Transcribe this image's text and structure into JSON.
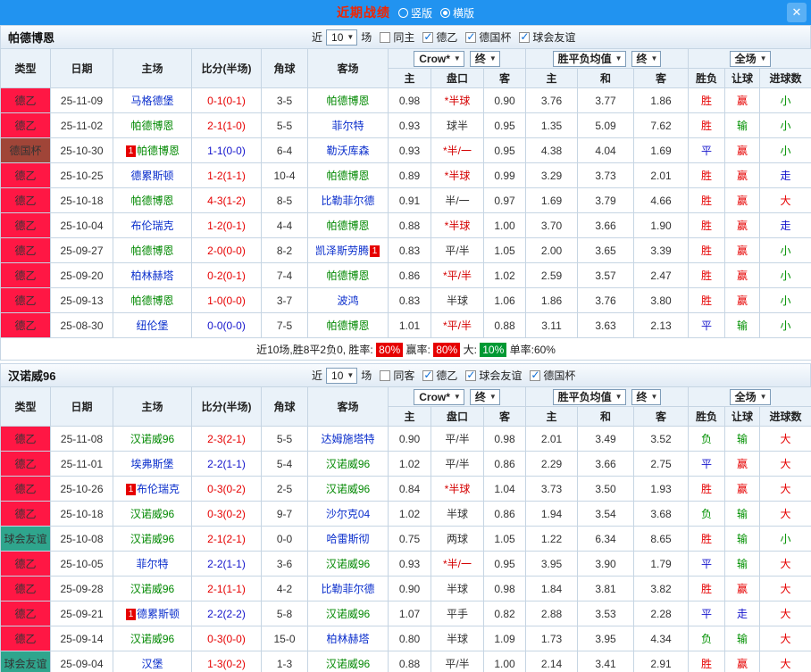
{
  "colors": {
    "topbar_bg": "#2193f0",
    "title": "#f22500",
    "win": "#e60000",
    "draw": "#1414cc",
    "lose": "#009000",
    "self_team": "#008800",
    "opp_team": "#0a2ecc",
    "odds": "#294f8a",
    "handicap_star": "#d40000",
    "type": {
      "德乙": "#ff1744",
      "德国杯": "#a04538",
      "球会友谊": "#2fa58d"
    }
  },
  "badge_text": "1",
  "topbar": {
    "title": "近期战绩",
    "vertical_label": "竖版",
    "horizontal_label": "横版",
    "selected": "横版",
    "close_glyph": "✕"
  },
  "table_header": {
    "type": "类型",
    "date": "日期",
    "home": "主场",
    "score": "比分(半场)",
    "corner": "角球",
    "away": "客场",
    "bookmaker": "Crow*",
    "final": "终",
    "europe": "胜平负均值",
    "scope": "全场",
    "sub": [
      "主",
      "盘口",
      "客",
      "主",
      "和",
      "客",
      "胜负",
      "让球",
      "进球数"
    ]
  },
  "sections": [
    {
      "team": "帕德博恩",
      "filter": {
        "near_label": "近",
        "count": "10",
        "games_label": "场",
        "same_label": "同主",
        "same_checked": false,
        "leagues": [
          {
            "label": "德乙",
            "checked": true
          },
          {
            "label": "德国杯",
            "checked": true
          },
          {
            "label": "球会友谊",
            "checked": true
          }
        ]
      },
      "rows": [
        {
          "lg": "德乙",
          "d": "25-11-09",
          "h": "马格德堡",
          "hc": "b",
          "s": "0-1(0-1)",
          "sc": "r",
          "cn": "3-5",
          "a": "帕德博恩",
          "ac": "g",
          "o": [
            "0.98",
            "*半球",
            "0.90",
            "3.76",
            "3.77",
            "1.86"
          ],
          "r": [
            "胜",
            "赢",
            "小"
          ]
        },
        {
          "lg": "德乙",
          "d": "25-11-02",
          "h": "帕德博恩",
          "hc": "g",
          "s": "2-1(1-0)",
          "sc": "r",
          "cn": "5-5",
          "a": "菲尔特",
          "ac": "b",
          "o": [
            "0.93",
            "球半",
            "0.95",
            "1.35",
            "5.09",
            "7.62"
          ],
          "r": [
            "胜",
            "输",
            "小"
          ]
        },
        {
          "lg": "德国杯",
          "d": "25-10-30",
          "h": "帕德博恩",
          "hc": "g",
          "hb": "pre",
          "s": "1-1(0-0)",
          "sc": "d",
          "cn": "6-4",
          "a": "勒沃库森",
          "ac": "b",
          "o": [
            "0.93",
            "*半/一",
            "0.95",
            "4.38",
            "4.04",
            "1.69"
          ],
          "r": [
            "平",
            "赢",
            "小"
          ]
        },
        {
          "lg": "德乙",
          "d": "25-10-25",
          "h": "德累斯顿",
          "hc": "b",
          "s": "1-2(1-1)",
          "sc": "r",
          "cn": "10-4",
          "a": "帕德博恩",
          "ac": "g",
          "o": [
            "0.89",
            "*半球",
            "0.99",
            "3.29",
            "3.73",
            "2.01"
          ],
          "r": [
            "胜",
            "赢",
            "走"
          ]
        },
        {
          "lg": "德乙",
          "d": "25-10-18",
          "h": "帕德博恩",
          "hc": "g",
          "s": "4-3(1-2)",
          "sc": "r",
          "cn": "8-5",
          "a": "比勒菲尔德",
          "ac": "b",
          "o": [
            "0.91",
            "半/一",
            "0.97",
            "1.69",
            "3.79",
            "4.66"
          ],
          "r": [
            "胜",
            "赢",
            "大"
          ]
        },
        {
          "lg": "德乙",
          "d": "25-10-04",
          "h": "布伦瑞克",
          "hc": "b",
          "s": "1-2(0-1)",
          "sc": "r",
          "cn": "4-4",
          "a": "帕德博恩",
          "ac": "g",
          "o": [
            "0.88",
            "*半球",
            "1.00",
            "3.70",
            "3.66",
            "1.90"
          ],
          "r": [
            "胜",
            "赢",
            "走"
          ]
        },
        {
          "lg": "德乙",
          "d": "25-09-27",
          "h": "帕德博恩",
          "hc": "g",
          "s": "2-0(0-0)",
          "sc": "r",
          "cn": "8-2",
          "a": "凯泽斯劳腾",
          "ac": "b",
          "ab": "post",
          "o": [
            "0.83",
            "平/半",
            "1.05",
            "2.00",
            "3.65",
            "3.39"
          ],
          "r": [
            "胜",
            "赢",
            "小"
          ]
        },
        {
          "lg": "德乙",
          "d": "25-09-20",
          "h": "柏林赫塔",
          "hc": "b",
          "s": "0-2(0-1)",
          "sc": "r",
          "cn": "7-4",
          "a": "帕德博恩",
          "ac": "g",
          "o": [
            "0.86",
            "*平/半",
            "1.02",
            "2.59",
            "3.57",
            "2.47"
          ],
          "r": [
            "胜",
            "赢",
            "小"
          ]
        },
        {
          "lg": "德乙",
          "d": "25-09-13",
          "h": "帕德博恩",
          "hc": "g",
          "s": "1-0(0-0)",
          "sc": "r",
          "cn": "3-7",
          "a": "波鸿",
          "ac": "b",
          "o": [
            "0.83",
            "半球",
            "1.06",
            "1.86",
            "3.76",
            "3.80"
          ],
          "r": [
            "胜",
            "赢",
            "小"
          ]
        },
        {
          "lg": "德乙",
          "d": "25-08-30",
          "h": "纽伦堡",
          "hc": "b",
          "s": "0-0(0-0)",
          "sc": "d",
          "cn": "7-5",
          "a": "帕德博恩",
          "ac": "g",
          "o": [
            "1.01",
            "*平/半",
            "0.88",
            "3.11",
            "3.63",
            "2.13"
          ],
          "r": [
            "平",
            "输",
            "小"
          ]
        }
      ],
      "summary": [
        {
          "t": "近10场,胜8平2负0, 胜率:"
        },
        {
          "v": "80%",
          "bg": "#e60000"
        },
        {
          "t": "赢率:"
        },
        {
          "v": "80%",
          "bg": "#e60000"
        },
        {
          "t": "大:"
        },
        {
          "v": "10%",
          "bg": "#009933"
        },
        {
          "t": "单率:60%"
        }
      ]
    },
    {
      "team": "汉诺威96",
      "filter": {
        "near_label": "近",
        "count": "10",
        "games_label": "场",
        "same_label": "同客",
        "same_checked": false,
        "leagues": [
          {
            "label": "德乙",
            "checked": true
          },
          {
            "label": "球会友谊",
            "checked": true
          },
          {
            "label": "德国杯",
            "checked": true
          }
        ]
      },
      "rows": [
        {
          "lg": "德乙",
          "d": "25-11-08",
          "h": "汉诺威96",
          "hc": "g",
          "s": "2-3(2-1)",
          "sc": "r",
          "cn": "5-5",
          "a": "达姆施塔特",
          "ac": "b",
          "o": [
            "0.90",
            "平/半",
            "0.98",
            "2.01",
            "3.49",
            "3.52"
          ],
          "r": [
            "负",
            "输",
            "大"
          ]
        },
        {
          "lg": "德乙",
          "d": "25-11-01",
          "h": "埃弗斯堡",
          "hc": "b",
          "s": "2-2(1-1)",
          "sc": "d",
          "cn": "5-4",
          "a": "汉诺威96",
          "ac": "g",
          "o": [
            "1.02",
            "平/半",
            "0.86",
            "2.29",
            "3.66",
            "2.75"
          ],
          "r": [
            "平",
            "赢",
            "大"
          ]
        },
        {
          "lg": "德乙",
          "d": "25-10-26",
          "h": "布伦瑞克",
          "hc": "b",
          "hb": "pre",
          "s": "0-3(0-2)",
          "sc": "r",
          "cn": "2-5",
          "a": "汉诺威96",
          "ac": "g",
          "o": [
            "0.84",
            "*半球",
            "1.04",
            "3.73",
            "3.50",
            "1.93"
          ],
          "r": [
            "胜",
            "赢",
            "大"
          ]
        },
        {
          "lg": "德乙",
          "d": "25-10-18",
          "h": "汉诺威96",
          "hc": "g",
          "s": "0-3(0-2)",
          "sc": "r",
          "cn": "9-7",
          "a": "沙尔克04",
          "ac": "b",
          "o": [
            "1.02",
            "半球",
            "0.86",
            "1.94",
            "3.54",
            "3.68"
          ],
          "r": [
            "负",
            "输",
            "大"
          ]
        },
        {
          "lg": "球会友谊",
          "d": "25-10-08",
          "h": "汉诺威96",
          "hc": "g",
          "s": "2-1(2-1)",
          "sc": "r",
          "cn": "0-0",
          "a": "哈雷斯彻",
          "ac": "b",
          "o": [
            "0.75",
            "两球",
            "1.05",
            "1.22",
            "6.34",
            "8.65"
          ],
          "r": [
            "胜",
            "输",
            "小"
          ]
        },
        {
          "lg": "德乙",
          "d": "25-10-05",
          "h": "菲尔特",
          "hc": "b",
          "s": "2-2(1-1)",
          "sc": "d",
          "cn": "3-6",
          "a": "汉诺威96",
          "ac": "g",
          "o": [
            "0.93",
            "*半/一",
            "0.95",
            "3.95",
            "3.90",
            "1.79"
          ],
          "r": [
            "平",
            "输",
            "大"
          ]
        },
        {
          "lg": "德乙",
          "d": "25-09-28",
          "h": "汉诺威96",
          "hc": "g",
          "s": "2-1(1-1)",
          "sc": "r",
          "cn": "4-2",
          "a": "比勒菲尔德",
          "ac": "b",
          "o": [
            "0.90",
            "半球",
            "0.98",
            "1.84",
            "3.81",
            "3.82"
          ],
          "r": [
            "胜",
            "赢",
            "大"
          ]
        },
        {
          "lg": "德乙",
          "d": "25-09-21",
          "h": "德累斯顿",
          "hc": "b",
          "hb": "pre",
          "s": "2-2(2-2)",
          "sc": "d",
          "cn": "5-8",
          "a": "汉诺威96",
          "ac": "g",
          "o": [
            "1.07",
            "平手",
            "0.82",
            "2.88",
            "3.53",
            "2.28"
          ],
          "r": [
            "平",
            "走",
            "大"
          ]
        },
        {
          "lg": "德乙",
          "d": "25-09-14",
          "h": "汉诺威96",
          "hc": "g",
          "s": "0-3(0-0)",
          "sc": "r",
          "cn": "15-0",
          "a": "柏林赫塔",
          "ac": "b",
          "o": [
            "0.80",
            "半球",
            "1.09",
            "1.73",
            "3.95",
            "4.34"
          ],
          "r": [
            "负",
            "输",
            "大"
          ]
        },
        {
          "lg": "球会友谊",
          "d": "25-09-04",
          "h": "汉堡",
          "hc": "b",
          "s": "1-3(0-2)",
          "sc": "r",
          "cn": "1-3",
          "a": "汉诺威96",
          "ac": "g",
          "o": [
            "0.88",
            "平/半",
            "1.00",
            "2.14",
            "3.41",
            "2.91"
          ],
          "r": [
            "胜",
            "赢",
            "大"
          ]
        }
      ]
    }
  ]
}
